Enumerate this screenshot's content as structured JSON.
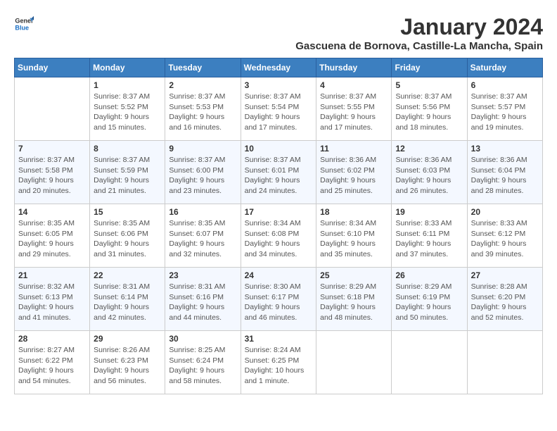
{
  "header": {
    "logo_general": "General",
    "logo_blue": "Blue",
    "month_title": "January 2024",
    "location": "Gascuena de Bornova, Castille-La Mancha, Spain"
  },
  "columns": [
    "Sunday",
    "Monday",
    "Tuesday",
    "Wednesday",
    "Thursday",
    "Friday",
    "Saturday"
  ],
  "weeks": [
    [
      {
        "day": "",
        "info": ""
      },
      {
        "day": "1",
        "info": "Sunrise: 8:37 AM\nSunset: 5:52 PM\nDaylight: 9 hours and 15 minutes."
      },
      {
        "day": "2",
        "info": "Sunrise: 8:37 AM\nSunset: 5:53 PM\nDaylight: 9 hours and 16 minutes."
      },
      {
        "day": "3",
        "info": "Sunrise: 8:37 AM\nSunset: 5:54 PM\nDaylight: 9 hours and 17 minutes."
      },
      {
        "day": "4",
        "info": "Sunrise: 8:37 AM\nSunset: 5:55 PM\nDaylight: 9 hours and 17 minutes."
      },
      {
        "day": "5",
        "info": "Sunrise: 8:37 AM\nSunset: 5:56 PM\nDaylight: 9 hours and 18 minutes."
      },
      {
        "day": "6",
        "info": "Sunrise: 8:37 AM\nSunset: 5:57 PM\nDaylight: 9 hours and 19 minutes."
      }
    ],
    [
      {
        "day": "7",
        "info": "Sunrise: 8:37 AM\nSunset: 5:58 PM\nDaylight: 9 hours and 20 minutes."
      },
      {
        "day": "8",
        "info": "Sunrise: 8:37 AM\nSunset: 5:59 PM\nDaylight: 9 hours and 21 minutes."
      },
      {
        "day": "9",
        "info": "Sunrise: 8:37 AM\nSunset: 6:00 PM\nDaylight: 9 hours and 23 minutes."
      },
      {
        "day": "10",
        "info": "Sunrise: 8:37 AM\nSunset: 6:01 PM\nDaylight: 9 hours and 24 minutes."
      },
      {
        "day": "11",
        "info": "Sunrise: 8:36 AM\nSunset: 6:02 PM\nDaylight: 9 hours and 25 minutes."
      },
      {
        "day": "12",
        "info": "Sunrise: 8:36 AM\nSunset: 6:03 PM\nDaylight: 9 hours and 26 minutes."
      },
      {
        "day": "13",
        "info": "Sunrise: 8:36 AM\nSunset: 6:04 PM\nDaylight: 9 hours and 28 minutes."
      }
    ],
    [
      {
        "day": "14",
        "info": "Sunrise: 8:35 AM\nSunset: 6:05 PM\nDaylight: 9 hours and 29 minutes."
      },
      {
        "day": "15",
        "info": "Sunrise: 8:35 AM\nSunset: 6:06 PM\nDaylight: 9 hours and 31 minutes."
      },
      {
        "day": "16",
        "info": "Sunrise: 8:35 AM\nSunset: 6:07 PM\nDaylight: 9 hours and 32 minutes."
      },
      {
        "day": "17",
        "info": "Sunrise: 8:34 AM\nSunset: 6:08 PM\nDaylight: 9 hours and 34 minutes."
      },
      {
        "day": "18",
        "info": "Sunrise: 8:34 AM\nSunset: 6:10 PM\nDaylight: 9 hours and 35 minutes."
      },
      {
        "day": "19",
        "info": "Sunrise: 8:33 AM\nSunset: 6:11 PM\nDaylight: 9 hours and 37 minutes."
      },
      {
        "day": "20",
        "info": "Sunrise: 8:33 AM\nSunset: 6:12 PM\nDaylight: 9 hours and 39 minutes."
      }
    ],
    [
      {
        "day": "21",
        "info": "Sunrise: 8:32 AM\nSunset: 6:13 PM\nDaylight: 9 hours and 41 minutes."
      },
      {
        "day": "22",
        "info": "Sunrise: 8:31 AM\nSunset: 6:14 PM\nDaylight: 9 hours and 42 minutes."
      },
      {
        "day": "23",
        "info": "Sunrise: 8:31 AM\nSunset: 6:16 PM\nDaylight: 9 hours and 44 minutes."
      },
      {
        "day": "24",
        "info": "Sunrise: 8:30 AM\nSunset: 6:17 PM\nDaylight: 9 hours and 46 minutes."
      },
      {
        "day": "25",
        "info": "Sunrise: 8:29 AM\nSunset: 6:18 PM\nDaylight: 9 hours and 48 minutes."
      },
      {
        "day": "26",
        "info": "Sunrise: 8:29 AM\nSunset: 6:19 PM\nDaylight: 9 hours and 50 minutes."
      },
      {
        "day": "27",
        "info": "Sunrise: 8:28 AM\nSunset: 6:20 PM\nDaylight: 9 hours and 52 minutes."
      }
    ],
    [
      {
        "day": "28",
        "info": "Sunrise: 8:27 AM\nSunset: 6:22 PM\nDaylight: 9 hours and 54 minutes."
      },
      {
        "day": "29",
        "info": "Sunrise: 8:26 AM\nSunset: 6:23 PM\nDaylight: 9 hours and 56 minutes."
      },
      {
        "day": "30",
        "info": "Sunrise: 8:25 AM\nSunset: 6:24 PM\nDaylight: 9 hours and 58 minutes."
      },
      {
        "day": "31",
        "info": "Sunrise: 8:24 AM\nSunset: 6:25 PM\nDaylight: 10 hours and 1 minute."
      },
      {
        "day": "",
        "info": ""
      },
      {
        "day": "",
        "info": ""
      },
      {
        "day": "",
        "info": ""
      }
    ]
  ]
}
